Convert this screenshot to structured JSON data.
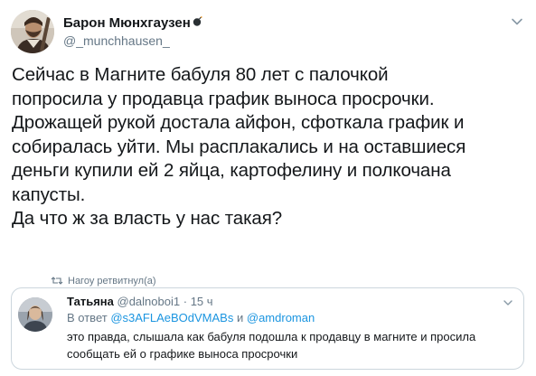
{
  "tweet": {
    "author": {
      "display_name": "Барон Мюнхгаузен",
      "handle": "@_munchhausen_",
      "name_badge_icon": "bomb-icon"
    },
    "menu_icon": "chevron-down-icon",
    "text_lines": [
      "Сейчас в Магните бабуля 80 лет с палочкой",
      "попросила у продавца график выноса просрочки.",
      "Дрожащей рукой достала айфон, сфоткала график и",
      "собиралась уйти. Мы расплакались и на оставшиеся",
      "деньги купили ей 2 яйца, картофелину и полкочана",
      "капусты.",
      "Да что ж за власть у нас такая?"
    ]
  },
  "retweet_note": {
    "icon": "retweet-icon",
    "text": "Нагоу ретвитнул(а)"
  },
  "quoted_tweet": {
    "display_name": "Татьяна",
    "handle": "@dalnoboi1",
    "separator": "·",
    "time": "15 ч",
    "reply_prefix": "В ответ",
    "mention_1": "@s3AFLAeBOdVMABs",
    "reply_joiner": "и",
    "mention_2": "@amdroman",
    "text": "это правда,  слышала как бабуля подошла к продавцу в магните и просила сообщать ей о графике выноса просрочки",
    "menu_icon": "chevron-down-icon"
  },
  "colors": {
    "text": "#14171a",
    "secondary": "#657786",
    "link": "#1b95e0",
    "border": "#ccd6dd"
  }
}
